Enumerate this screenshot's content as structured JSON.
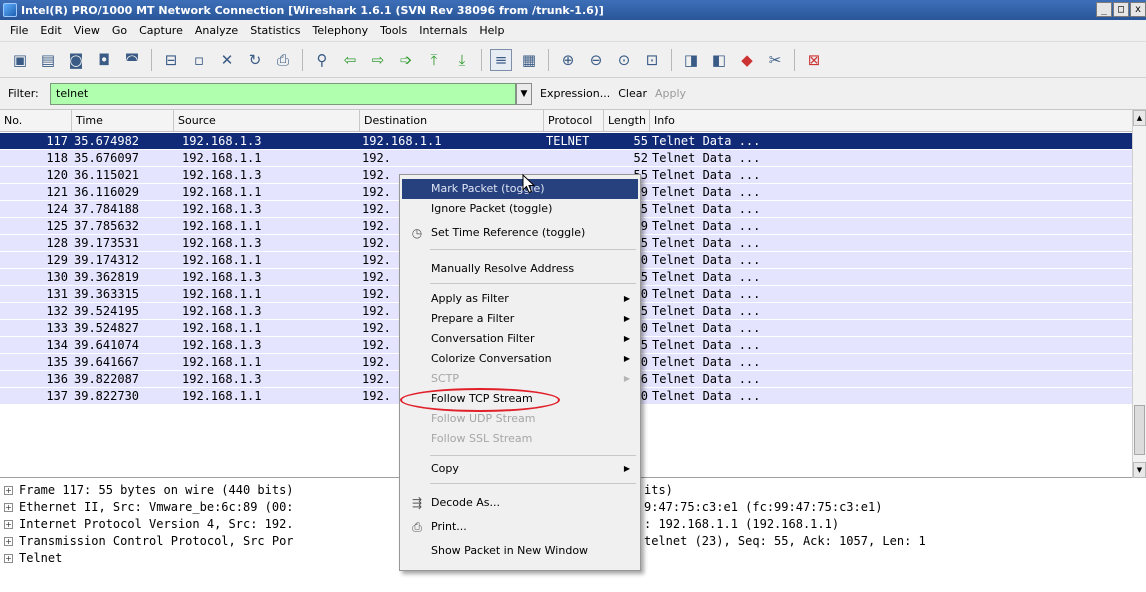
{
  "window": {
    "title": "Intel(R) PRO/1000 MT Network Connection  [Wireshark 1.6.1  (SVN Rev 38096 from /trunk-1.6)]",
    "controls": [
      "_",
      "□",
      "x"
    ]
  },
  "menu": [
    "File",
    "Edit",
    "View",
    "Go",
    "Capture",
    "Analyze",
    "Statistics",
    "Telephony",
    "Tools",
    "Internals",
    "Help"
  ],
  "filter": {
    "label": "Filter:",
    "value": "telnet",
    "expression": "Expression...",
    "clear": "Clear",
    "apply": "Apply"
  },
  "packet_list": {
    "columns": [
      "No.",
      "Time",
      "Source",
      "Destination",
      "Protocol",
      "Length",
      "Info"
    ],
    "rows": [
      {
        "no": "117",
        "time": "35.674982",
        "src": "192.168.1.3",
        "dst": "192.168.1.1",
        "proto": "TELNET",
        "len": "55",
        "info": "Telnet Data ..."
      },
      {
        "no": "118",
        "time": "35.676097",
        "src": "192.168.1.1",
        "dst": "192.",
        "proto": "",
        "len": "52",
        "info": "Telnet Data ..."
      },
      {
        "no": "120",
        "time": "36.115021",
        "src": "192.168.1.3",
        "dst": "192.",
        "proto": "",
        "len": "55",
        "info": "Telnet Data ..."
      },
      {
        "no": "121",
        "time": "36.116029",
        "src": "192.168.1.1",
        "dst": "192.",
        "proto": "",
        "len": "49",
        "info": "Telnet Data ..."
      },
      {
        "no": "124",
        "time": "37.784188",
        "src": "192.168.1.3",
        "dst": "192.",
        "proto": "",
        "len": "55",
        "info": "Telnet Data ..."
      },
      {
        "no": "125",
        "time": "37.785632",
        "src": "192.168.1.1",
        "dst": "192.",
        "proto": "",
        "len": "309",
        "info": "Telnet Data ..."
      },
      {
        "no": "128",
        "time": "39.173531",
        "src": "192.168.1.3",
        "dst": "192.",
        "proto": "",
        "len": "55",
        "info": "Telnet Data ..."
      },
      {
        "no": "129",
        "time": "39.174312",
        "src": "192.168.1.1",
        "dst": "192.",
        "proto": "",
        "len": "60",
        "info": "Telnet Data ..."
      },
      {
        "no": "130",
        "time": "39.362819",
        "src": "192.168.1.3",
        "dst": "192.",
        "proto": "",
        "len": "55",
        "info": "Telnet Data ..."
      },
      {
        "no": "131",
        "time": "39.363315",
        "src": "192.168.1.1",
        "dst": "192.",
        "proto": "",
        "len": "60",
        "info": "Telnet Data ..."
      },
      {
        "no": "132",
        "time": "39.524195",
        "src": "192.168.1.3",
        "dst": "192.",
        "proto": "",
        "len": "55",
        "info": "Telnet Data ..."
      },
      {
        "no": "133",
        "time": "39.524827",
        "src": "192.168.1.1",
        "dst": "192.",
        "proto": "",
        "len": "60",
        "info": "Telnet Data ..."
      },
      {
        "no": "134",
        "time": "39.641074",
        "src": "192.168.1.3",
        "dst": "192.",
        "proto": "",
        "len": "55",
        "info": "Telnet Data ..."
      },
      {
        "no": "135",
        "time": "39.641667",
        "src": "192.168.1.1",
        "dst": "192.",
        "proto": "",
        "len": "60",
        "info": "Telnet Data ..."
      },
      {
        "no": "136",
        "time": "39.822087",
        "src": "192.168.1.3",
        "dst": "192.",
        "proto": "",
        "len": "56",
        "info": "Telnet Data ..."
      },
      {
        "no": "137",
        "time": "39.822730",
        "src": "192.168.1.1",
        "dst": "192.",
        "proto": "",
        "len": "60",
        "info": "Telnet Data ..."
      }
    ]
  },
  "details": [
    {
      "left": "Frame 117: 55 bytes on wire (440 bits)",
      "right": "its)"
    },
    {
      "left": "Ethernet II, Src: Vmware_be:6c:89 (00:",
      "right": "9:47:75:c3:e1 (fc:99:47:75:c3:e1)"
    },
    {
      "left": "Internet Protocol Version 4, Src: 192.",
      "right": ": 192.168.1.1 (192.168.1.1)"
    },
    {
      "left": "Transmission Control Protocol, Src Por",
      "right": "telnet (23), Seq: 55, Ack: 1057, Len: 1"
    },
    {
      "left": "Telnet",
      "right": ""
    }
  ],
  "context_menu": {
    "mark": "Mark Packet (toggle)",
    "ignore": "Ignore Packet (toggle)",
    "time_ref": "Set Time Reference (toggle)",
    "resolve": "Manually Resolve Address",
    "apply_filter": "Apply as Filter",
    "prepare_filter": "Prepare a Filter",
    "conv_filter": "Conversation Filter",
    "colorize": "Colorize Conversation",
    "sctp": "SCTP",
    "follow_tcp": "Follow TCP Stream",
    "follow_udp": "Follow UDP Stream",
    "follow_ssl": "Follow SSL Stream",
    "copy": "Copy",
    "decode_as": "Decode As...",
    "print": "Print...",
    "show_new_window": "Show Packet in New Window"
  },
  "colors": {
    "selected_row": "#102a78",
    "row_bg": "#e4e4ff",
    "filter_bg": "#afffaf",
    "highlight_ring": "#e0202a"
  }
}
